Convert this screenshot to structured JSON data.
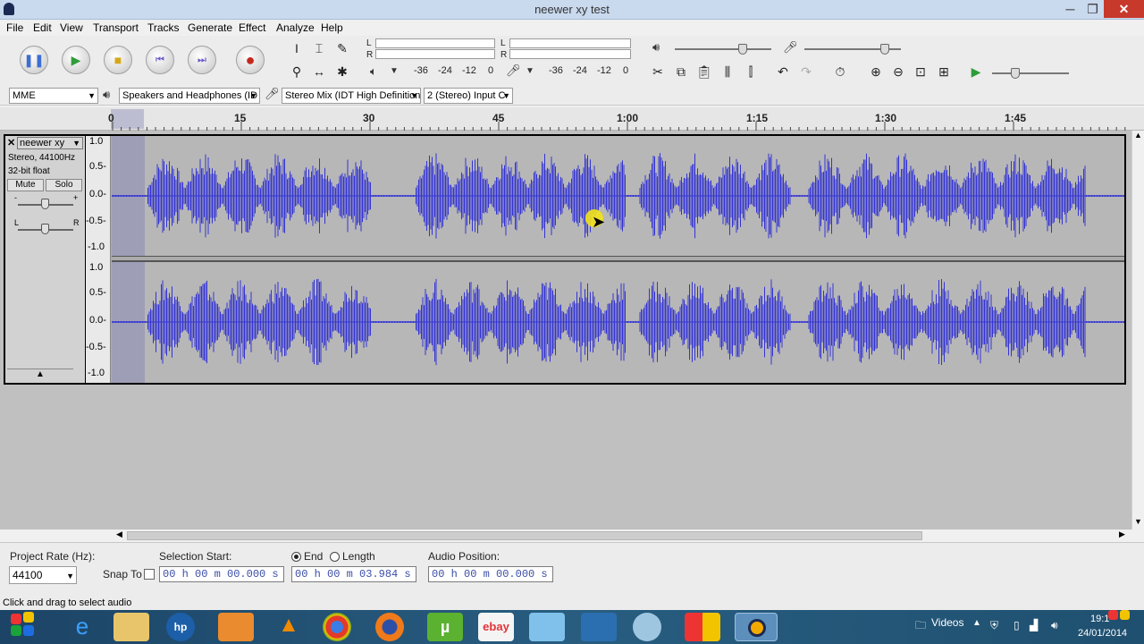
{
  "window": {
    "title": "neewer xy test",
    "minimize": "─",
    "maximize": "❐",
    "close": "✕"
  },
  "menu": [
    "File",
    "Edit",
    "View",
    "Transport",
    "Tracks",
    "Generate",
    "Effect",
    "Analyze",
    "Help"
  ],
  "meters": {
    "play_left": "L",
    "play_right": "R",
    "rec_left": "L",
    "rec_right": "R",
    "play_ticks": [
      "-36",
      "-24",
      "-12",
      "0"
    ],
    "rec_ticks": [
      "-36",
      "-24",
      "-12",
      "0"
    ]
  },
  "device": {
    "host": "MME",
    "output": "Speakers and Headphones (ID",
    "input": "Stereo Mix (IDT High Definition",
    "channels": "2 (Stereo) Input C"
  },
  "ruler": {
    "labels": [
      "0",
      "15",
      "30",
      "45",
      "1:00",
      "1:15",
      "1:30",
      "1:45"
    ]
  },
  "track": {
    "name": "neewer xy",
    "format": "Stereo, 44100Hz",
    "bits": "32-bit float",
    "mute": "Mute",
    "solo": "Solo",
    "gain_minus": "-",
    "gain_plus": "+",
    "pan_left": "L",
    "pan_right": "R",
    "scale": [
      "1.0",
      "0.5-",
      "0.0-",
      "-0.5-",
      "-1.0"
    ]
  },
  "selection": {
    "project_rate_label": "Project Rate (Hz):",
    "project_rate": "44100",
    "snap_to": "Snap To",
    "selection_start_label": "Selection Start:",
    "end_label": "End",
    "length_label": "Length",
    "selection_start": "00 h 00 m 00.000 s",
    "selection_end": "00 h 00 m 03.984 s",
    "audio_position_label": "Audio Position:",
    "audio_position": "00 h 00 m 00.000 s"
  },
  "status": "Click and drag to select audio",
  "taskbar": {
    "videos_label": "Videos",
    "time": "19:1",
    "date": "24/01/2014"
  }
}
